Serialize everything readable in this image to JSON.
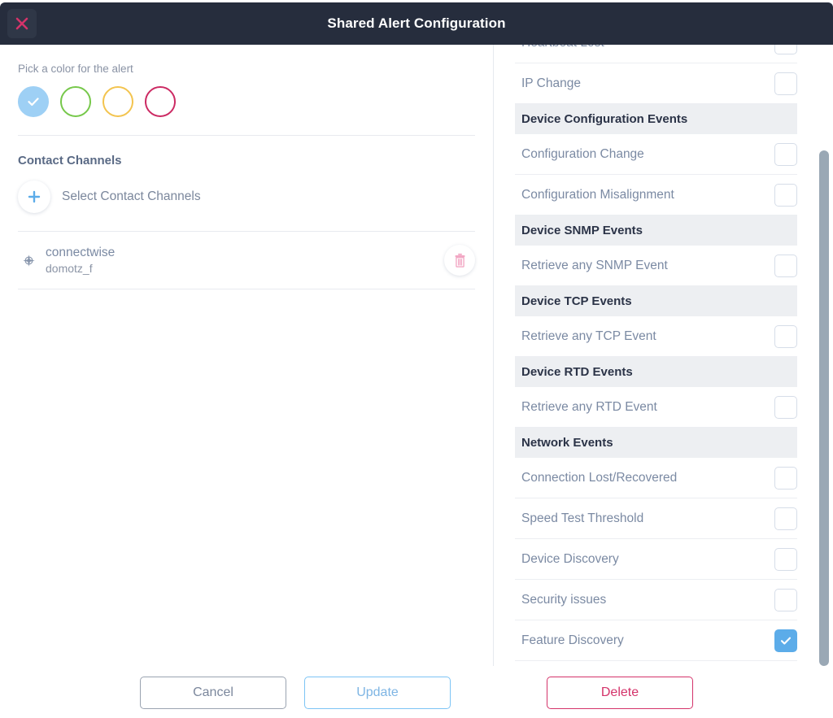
{
  "header": {
    "title": "Shared Alert Configuration",
    "close_icon": "close-x-icon"
  },
  "left_panel": {
    "color_picker": {
      "label": "Pick a color for the alert",
      "selected_index": 0,
      "swatches": [
        {
          "name": "blue",
          "color": "#9ed0f5",
          "fill": "#9ed0f5",
          "selected": true
        },
        {
          "name": "green",
          "color": "#76c84a",
          "fill": "#ffffff",
          "selected": false
        },
        {
          "name": "yellow",
          "color": "#f5c council",
          "fill": "#ffffff",
          "selected": false
        },
        {
          "name": "pink",
          "color": "#cc2a63",
          "fill": "#ffffff",
          "selected": false
        }
      ]
    },
    "contact_channels": {
      "title": "Contact Channels",
      "add_label": "Select Contact Channels",
      "add_icon": "plus-icon",
      "rows": [
        {
          "icon": "compass-icon",
          "name": "connectwise",
          "sub": "domotz_f",
          "delete_icon": "trash-icon"
        }
      ]
    }
  },
  "right_panel": {
    "groups": [
      {
        "type": "items",
        "items": [
          {
            "label": "Heartbeat Lost",
            "checked": false
          },
          {
            "label": "IP Change",
            "checked": false
          }
        ]
      },
      {
        "type": "group",
        "header": "Device Configuration Events",
        "items": [
          {
            "label": "Configuration Change",
            "checked": false
          },
          {
            "label": "Configuration Misalignment",
            "checked": false
          }
        ]
      },
      {
        "type": "group",
        "header": "Device SNMP Events",
        "items": [
          {
            "label": "Retrieve any SNMP Event",
            "checked": false
          }
        ]
      },
      {
        "type": "group",
        "header": "Device TCP Events",
        "items": [
          {
            "label": "Retrieve any TCP Event",
            "checked": false
          }
        ]
      },
      {
        "type": "group",
        "header": "Device RTD Events",
        "items": [
          {
            "label": "Retrieve any RTD Event",
            "checked": false
          }
        ]
      },
      {
        "type": "group",
        "header": "Network Events",
        "items": [
          {
            "label": "Connection Lost/Recovered",
            "checked": false
          },
          {
            "label": "Speed Test Threshold",
            "checked": false
          },
          {
            "label": "Device Discovery",
            "checked": false
          },
          {
            "label": "Security issues",
            "checked": false
          },
          {
            "label": "Feature Discovery",
            "checked": true
          }
        ]
      }
    ]
  },
  "footer": {
    "cancel_label": "Cancel",
    "update_label": "Update",
    "delete_label": "Delete"
  },
  "colors": {
    "header_bg": "#262d3d",
    "accent_blue": "#5cace9",
    "accent_pink": "#d4336a",
    "group_header_bg": "#edeff2",
    "text_muted": "#7b8aa3"
  }
}
